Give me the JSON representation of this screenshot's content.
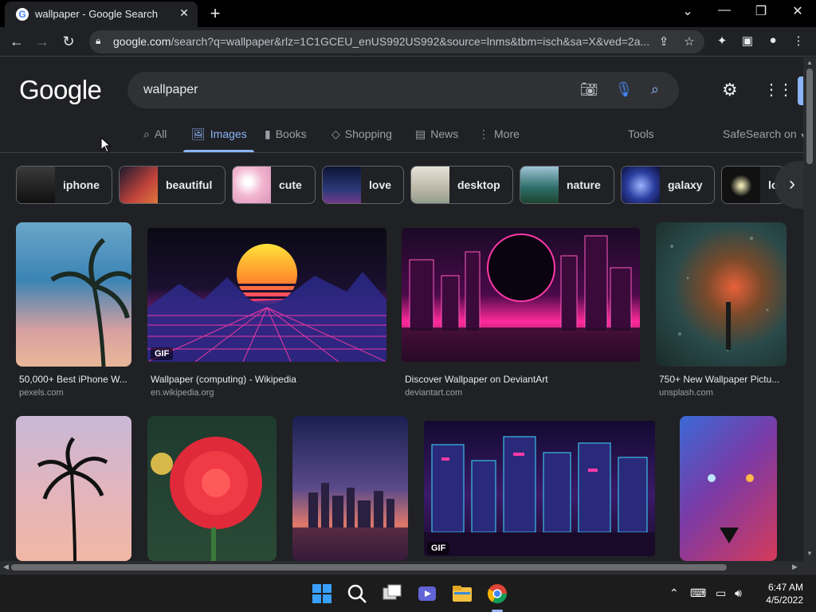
{
  "browser": {
    "tab_title": "wallpaper - Google Search",
    "favicon_letter": "G",
    "url_domain": "google.com",
    "url_path": "/search?q=wallpaper&rlz=1C1GCEU_enUS992US992&source=lnms&tbm=isch&sa=X&ved=2a...",
    "icons": {
      "back": "back-arrow-icon",
      "forward": "forward-arrow-icon",
      "reload": "reload-icon",
      "lock": "lock-icon",
      "share": "share-icon",
      "bookmark": "star-icon",
      "extensions": "puzzle-icon",
      "sidepanel": "side-panel-icon",
      "profile": "profile-icon",
      "menu": "kebab-menu-icon"
    }
  },
  "search": {
    "logo": "Google",
    "query": "wallpaper"
  },
  "nav_tabs": [
    {
      "label": "All",
      "icon": "search-icon"
    },
    {
      "label": "Images",
      "icon": "image-icon",
      "active": true
    },
    {
      "label": "Books",
      "icon": "book-icon"
    },
    {
      "label": "Shopping",
      "icon": "tag-icon"
    },
    {
      "label": "News",
      "icon": "news-icon"
    },
    {
      "label": "More",
      "icon": "vertical-dots-icon"
    }
  ],
  "tools_label": "Tools",
  "safesearch_label": "SafeSearch on",
  "chips": [
    {
      "label": "iphone",
      "color": "#2b2b2b"
    },
    {
      "label": "beautiful",
      "color": "#c2443c"
    },
    {
      "label": "cute",
      "color": "#f2b6d0"
    },
    {
      "label": "love",
      "color": "#1c2a5c"
    },
    {
      "label": "desktop",
      "color": "#c8c4b8"
    },
    {
      "label": "nature",
      "color": "#2f6f6a"
    },
    {
      "label": "galaxy",
      "color": "#2c3fa0"
    },
    {
      "label": "lo",
      "color": "#111111"
    }
  ],
  "results_row1": [
    {
      "caption": "50,000+ Best iPhone W...",
      "source": "pexels.com"
    },
    {
      "caption": "Wallpaper (computing) - Wikipedia",
      "source": "en.wikipedia.org",
      "badge": "GIF"
    },
    {
      "caption": "Discover Wallpaper on DeviantArt",
      "source": "deviantart.com"
    },
    {
      "caption": "750+ New Wallpaper Pictu...",
      "source": "unsplash.com"
    }
  ],
  "results_row2": [
    {
      "badge": ""
    },
    {
      "badge": ""
    },
    {
      "badge": ""
    },
    {
      "badge": "GIF"
    },
    {
      "badge": ""
    }
  ],
  "taskbar": {
    "time": "6:47 AM",
    "date": "4/5/2022"
  }
}
